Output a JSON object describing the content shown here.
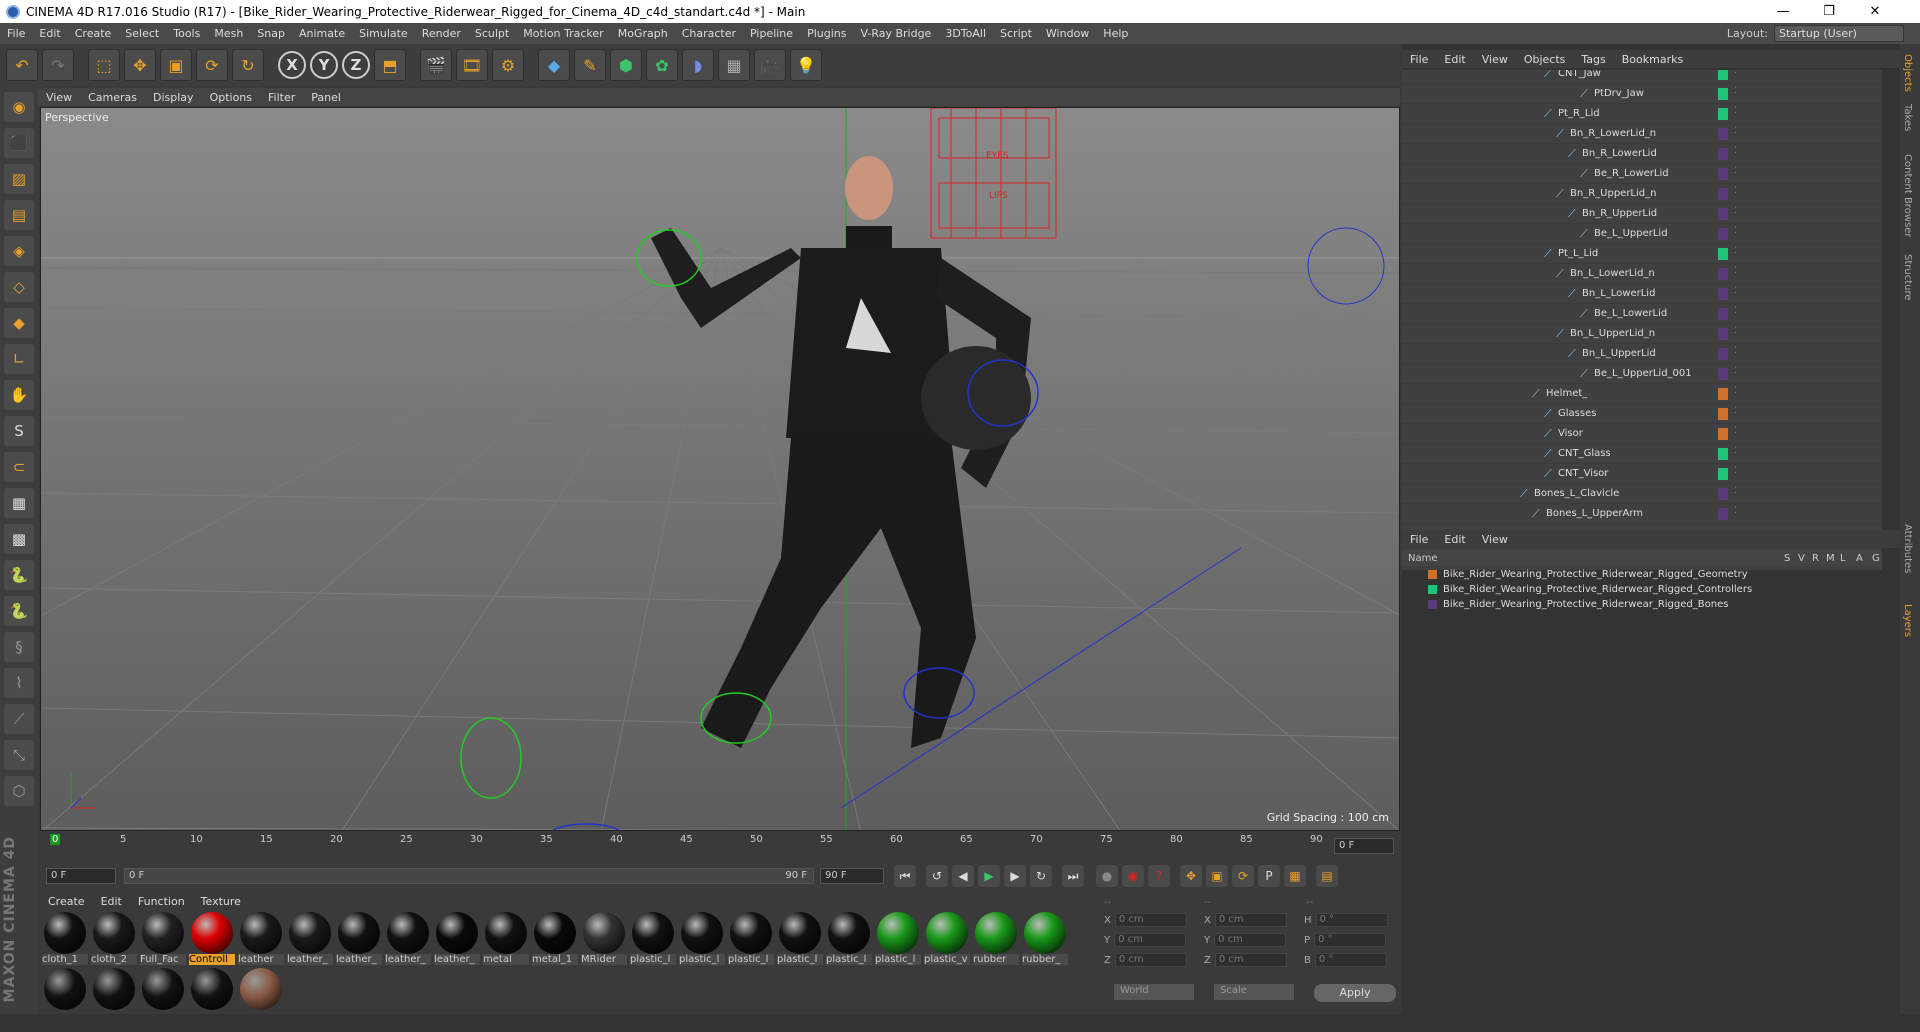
{
  "window": {
    "title": "CINEMA 4D R17.016 Studio (R17) - [Bike_Rider_Wearing_Protective_Riderwear_Rigged_for_Cinema_4D_c4d_standart.c4d *] - Main",
    "minimize": "—",
    "maximize": "❐",
    "close": "✕"
  },
  "menubar": {
    "items": [
      "File",
      "Edit",
      "Create",
      "Select",
      "Tools",
      "Mesh",
      "Snap",
      "Animate",
      "Simulate",
      "Render",
      "Sculpt",
      "Motion Tracker",
      "MoGraph",
      "Character",
      "Pipeline",
      "Plugins",
      "V-Ray Bridge",
      "3DToAll",
      "Script",
      "Window",
      "Help"
    ],
    "layout_label": "Layout:",
    "layout_value": "Startup (User)"
  },
  "toolbar": {
    "axis_x": "X",
    "axis_y": "Y",
    "axis_z": "Z"
  },
  "viewport": {
    "menu": [
      "View",
      "Cameras",
      "Display",
      "Options",
      "Filter",
      "Panel"
    ],
    "label": "Perspective",
    "grid_spacing": "Grid Spacing : 100 cm",
    "rig_labels": {
      "eyes": "EYES",
      "lips": "LIPS"
    }
  },
  "timeline": {
    "ticks": [
      "0",
      "5",
      "10",
      "15",
      "20",
      "25",
      "30",
      "35",
      "40",
      "45",
      "50",
      "55",
      "60",
      "65",
      "70",
      "75",
      "80",
      "85",
      "90"
    ],
    "current_frame": "0 F",
    "start_field": "0 F",
    "range_start": "0 F",
    "range_end": "90 F",
    "end_field": "90 F"
  },
  "materials": {
    "menu": [
      "Create",
      "Edit",
      "Function",
      "Texture"
    ],
    "items": [
      {
        "label": "cloth_1",
        "color": "#111"
      },
      {
        "label": "cloth_2",
        "color": "#1a1a1a"
      },
      {
        "label": "Full_Fac",
        "color": "#222"
      },
      {
        "label": "Controll",
        "color": "#d00",
        "selected": true
      },
      {
        "label": "leather",
        "color": "#1a1a1a"
      },
      {
        "label": "leather_",
        "color": "#1a1a1a"
      },
      {
        "label": "leather_",
        "color": "#111"
      },
      {
        "label": "leather_",
        "color": "#111"
      },
      {
        "label": "leather_",
        "color": "#0a0a0a"
      },
      {
        "label": "metal",
        "color": "#111"
      },
      {
        "label": "metal_1",
        "color": "#0a0a0a"
      },
      {
        "label": "MRider",
        "color": "#333"
      },
      {
        "label": "plastic_l",
        "color": "#111"
      },
      {
        "label": "plastic_l",
        "color": "#111"
      },
      {
        "label": "plastic_l",
        "color": "#111"
      },
      {
        "label": "plastic_l",
        "color": "#111"
      },
      {
        "label": "plastic_l",
        "color": "#111"
      },
      {
        "label": "plastic_l",
        "color": "#1a9a1a"
      },
      {
        "label": "plastic_v",
        "color": "#1a9a1a"
      },
      {
        "label": "rubber",
        "color": "#1a9a1a"
      },
      {
        "label": "rubber_",
        "color": "#1a9a1a"
      }
    ],
    "row2": [
      "#111",
      "#111",
      "#111",
      "#111",
      "#8a5a44"
    ]
  },
  "coords": {
    "header1": "--",
    "header2": "--",
    "header3": "--",
    "rows": [
      {
        "a": "X",
        "av": "0 cm",
        "b": "X",
        "bv": "0 cm",
        "c": "H",
        "cv": "0 °"
      },
      {
        "a": "Y",
        "av": "0 cm",
        "b": "Y",
        "bv": "0 cm",
        "c": "P",
        "cv": "0 °"
      },
      {
        "a": "Z",
        "av": "0 cm",
        "b": "Z",
        "bv": "0 cm",
        "c": "B",
        "cv": "0 °"
      }
    ],
    "world": "World",
    "scale": "Scale",
    "apply": "Apply"
  },
  "objects": {
    "menu": [
      "File",
      "Edit",
      "View",
      "Objects",
      "Tags",
      "Bookmarks"
    ],
    "rows": [
      {
        "name": "CNT_Jaw",
        "color": "#1fc47a"
      },
      {
        "name": "PtDrv_Jaw",
        "color": "#1fc47a"
      },
      {
        "name": "Pt_R_Lid",
        "color": "#1fc47a"
      },
      {
        "name": "Bn_R_LowerLid_n",
        "color": "#5a3a7a"
      },
      {
        "name": "Bn_R_LowerLid",
        "color": "#5a3a7a"
      },
      {
        "name": "Be_R_LowerLid",
        "color": "#5a3a7a"
      },
      {
        "name": "Bn_R_UpperLid_n",
        "color": "#5a3a7a"
      },
      {
        "name": "Bn_R_UpperLid",
        "color": "#5a3a7a"
      },
      {
        "name": "Be_L_UpperLid",
        "color": "#5a3a7a"
      },
      {
        "name": "Pt_L_Lid",
        "color": "#1fc47a"
      },
      {
        "name": "Bn_L_LowerLid_n",
        "color": "#5a3a7a"
      },
      {
        "name": "Bn_L_LowerLid",
        "color": "#5a3a7a"
      },
      {
        "name": "Be_L_LowerLid",
        "color": "#5a3a7a"
      },
      {
        "name": "Bn_L_UpperLid_n",
        "color": "#5a3a7a"
      },
      {
        "name": "Bn_L_UpperLid",
        "color": "#5a3a7a"
      },
      {
        "name": "Be_L_UpperLid_001",
        "color": "#5a3a7a"
      },
      {
        "name": "Helmet_",
        "color": "#d0702a"
      },
      {
        "name": "Glasses",
        "color": "#d0702a"
      },
      {
        "name": "Visor",
        "color": "#d0702a"
      },
      {
        "name": "CNT_Glass",
        "color": "#1fc47a"
      },
      {
        "name": "CNT_Visor",
        "color": "#1fc47a"
      },
      {
        "name": "Bones_L_Clavicle",
        "color": "#5a3a7a"
      },
      {
        "name": "Bones_L_UpperArm",
        "color": "#5a3a7a"
      }
    ]
  },
  "layers": {
    "menu": [
      "File",
      "Edit",
      "View"
    ],
    "columns": [
      "Name",
      "S",
      "V",
      "R",
      "M",
      "L",
      "A",
      "G"
    ],
    "rows": [
      {
        "name": "Bike_Rider_Wearing_Protective_Riderwear_Rigged_Geometry",
        "color": "#d0702a"
      },
      {
        "name": "Bike_Rider_Wearing_Protective_Riderwear_Rigged_Controllers",
        "color": "#1fc47a"
      },
      {
        "name": "Bike_Rider_Wearing_Protective_Riderwear_Rigged_Bones",
        "color": "#5a3a7a"
      }
    ]
  },
  "sidetabs": [
    "Objects",
    "Takes",
    "Content Browser",
    "Structure",
    "Attributes",
    "Layers"
  ]
}
